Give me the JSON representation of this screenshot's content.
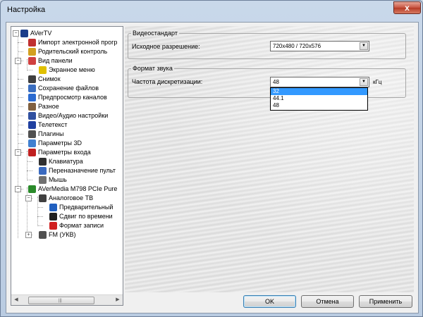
{
  "window": {
    "title": "Настройка",
    "close": "x"
  },
  "tree": {
    "items": [
      {
        "label": "AVerTV",
        "icon": "aver-logo-icon",
        "color": "#1c3d8a"
      },
      {
        "label": "Импорт электронной прогр",
        "icon": "import-icon",
        "color": "#c03030"
      },
      {
        "label": "Родительский контроль",
        "icon": "lock-icon",
        "color": "#d2a020"
      },
      {
        "label": "Вид панели",
        "icon": "palette-icon",
        "color": "#d04040"
      },
      {
        "label": "Экранное меню",
        "icon": "osd-menu-icon",
        "color": "#e0c000"
      },
      {
        "label": "Снимок",
        "icon": "camera-icon",
        "color": "#404040"
      },
      {
        "label": "Сохранение файлов",
        "icon": "save-folder-icon",
        "color": "#3a6ec0"
      },
      {
        "label": "Предпросмотр каналов",
        "icon": "eye-icon",
        "color": "#2a6ad0"
      },
      {
        "label": "Разное",
        "icon": "pencil-icon",
        "color": "#806040"
      },
      {
        "label": "Видео/Аудио настройки",
        "icon": "tools-icon",
        "color": "#3050a0"
      },
      {
        "label": "Телетекст",
        "icon": "teletext-icon",
        "color": "#2040a0"
      },
      {
        "label": "Плагины",
        "icon": "plugin-icon",
        "color": "#505050"
      },
      {
        "label": "Параметры 3D",
        "icon": "gear-3d-icon",
        "color": "#4080d0"
      },
      {
        "label": "Параметры входа",
        "icon": "input-icon",
        "color": "#c02020"
      },
      {
        "label": "Клавиатура",
        "icon": "keyboard-icon",
        "color": "#303030"
      },
      {
        "label": "Переназначение пульт",
        "icon": "remote-icon",
        "color": "#3a6ac0"
      },
      {
        "label": "Мышь",
        "icon": "mouse-icon",
        "color": "#707070"
      },
      {
        "label": "AVerMedia M798 PCIe Pure",
        "icon": "tv-card-icon",
        "color": "#2a8a2a"
      },
      {
        "label": "Аналоговое ТВ",
        "icon": "monitor-icon",
        "color": "#404040"
      },
      {
        "label": "Предварительный",
        "icon": "checklist-icon",
        "color": "#2060c0"
      },
      {
        "label": "Сдвиг по времени",
        "icon": "timeshift-icon",
        "color": "#202020"
      },
      {
        "label": "Формат записи",
        "icon": "record-icon",
        "color": "#d02020"
      },
      {
        "label": "FM (УКВ)",
        "icon": "radio-icon",
        "color": "#505050"
      }
    ]
  },
  "video": {
    "legend": "Видеостандарт",
    "resolution_label": "Исходное разрешение:",
    "resolution_value": "720x480 / 720x576"
  },
  "audio": {
    "legend": "Формат звука",
    "rate_label": "Частота дискретизации:",
    "rate_value": "48",
    "unit": "кГц",
    "options": [
      "32",
      "44.1",
      "48"
    ]
  },
  "buttons": {
    "ok": "OK",
    "cancel": "Отмена",
    "apply": "Применить"
  }
}
